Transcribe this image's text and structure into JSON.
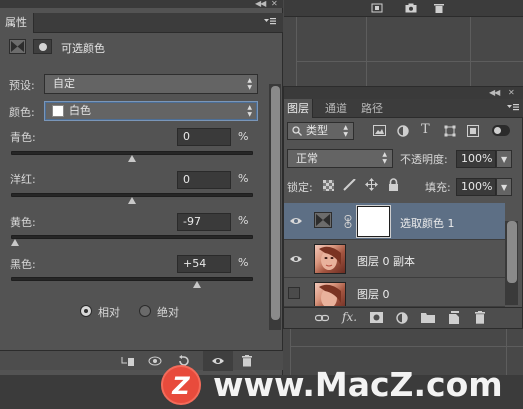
{
  "properties_panel": {
    "tab_label": "属性",
    "adjustment_title": "可选颜色",
    "preset": {
      "label": "预设:",
      "value": "自定"
    },
    "colors": {
      "label": "颜色:",
      "value": "白色",
      "swatch": "#ffffff"
    },
    "sliders": [
      {
        "label": "青色:",
        "value": "0",
        "unit": "%",
        "level": 0
      },
      {
        "label": "洋红:",
        "value": "0",
        "unit": "%",
        "level": 0
      },
      {
        "label": "黄色:",
        "value": "-97",
        "unit": "%",
        "level": -97
      },
      {
        "label": "黑色:",
        "value": "+54",
        "unit": "%",
        "level": 54
      }
    ],
    "method": {
      "relative_label": "相对",
      "absolute_label": "绝对",
      "selected": "相对"
    }
  },
  "layers_panel": {
    "tabs": [
      "图层",
      "通道",
      "路径"
    ],
    "active_tab": "图层",
    "filter_kind": "类型",
    "blend_mode": "正常",
    "opacity_label": "不透明度:",
    "opacity_value": "100%",
    "lock_label": "锁定:",
    "fill_label": "填充:",
    "fill_value": "100%",
    "layers": [
      {
        "name": "选取颜色 1",
        "visible": true,
        "selected": true,
        "type": "adjustment"
      },
      {
        "name": "图层 0 副本",
        "visible": true,
        "selected": false,
        "type": "image"
      },
      {
        "name": "图层 0",
        "visible": false,
        "selected": false,
        "type": "image"
      }
    ]
  },
  "watermark": {
    "logo_letter": "Z",
    "text": "www.MacZ.com"
  },
  "colors": {
    "panel": "#535353",
    "selection": "#5d6f85",
    "accent": "#e84b3c"
  },
  "icons": [
    "adjustment-icon",
    "mask-icon",
    "eye-icon",
    "link-icon",
    "trash-icon",
    "fx-icon",
    "folder-icon",
    "new-layer-icon",
    "reset-icon",
    "clip-icon",
    "lock-icon",
    "search-icon"
  ]
}
